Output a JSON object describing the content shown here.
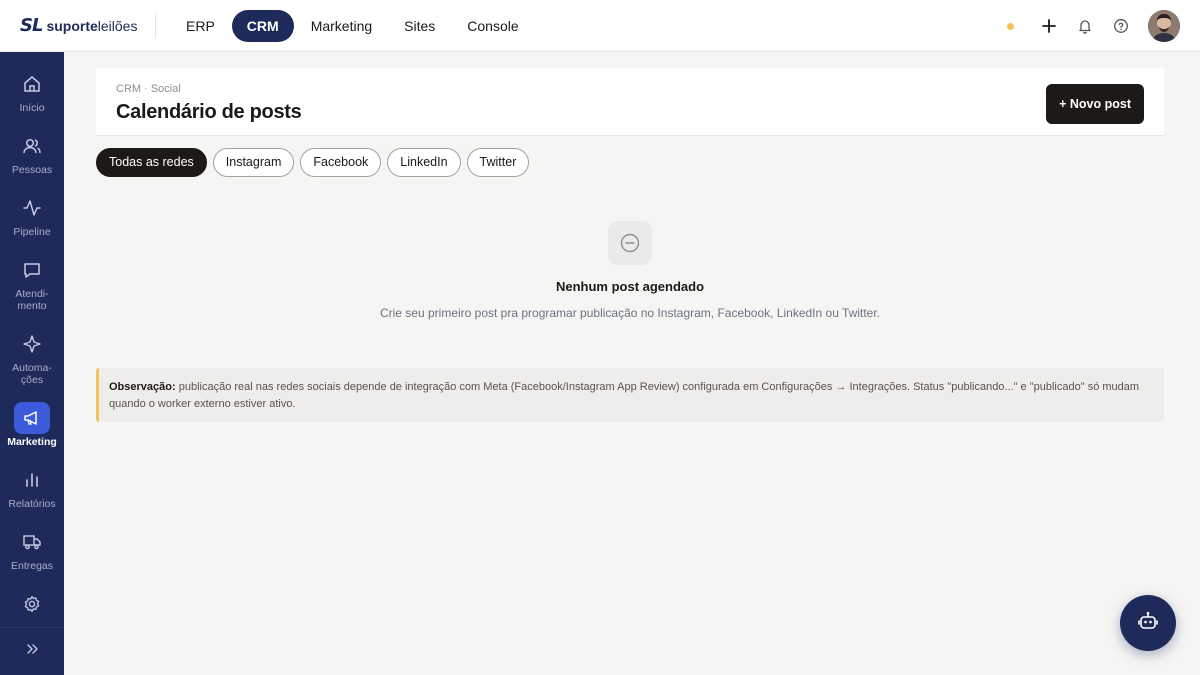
{
  "brand": {
    "mark": "SL",
    "name_bold": "suporte",
    "name_light": "leilões"
  },
  "topnav": {
    "items": [
      {
        "label": "ERP",
        "active": false
      },
      {
        "label": "CRM",
        "active": true
      },
      {
        "label": "Marketing",
        "active": false
      },
      {
        "label": "Sites",
        "active": false
      },
      {
        "label": "Console",
        "active": false
      }
    ]
  },
  "top_actions": {
    "status_color": "#f5c15a",
    "icons": [
      "plus-icon",
      "bell-icon",
      "help-icon"
    ],
    "avatar": "user-avatar"
  },
  "sidebar": {
    "items": [
      {
        "label": "Início",
        "icon": "home-icon"
      },
      {
        "label": "Pessoas",
        "icon": "users-icon"
      },
      {
        "label": "Pipeline",
        "icon": "activity-icon"
      },
      {
        "label": "Atendi-\nmento",
        "icon": "message-icon"
      },
      {
        "label": "Automa-\nções",
        "icon": "sparkle-icon"
      },
      {
        "label": "Marketing",
        "icon": "megaphone-icon",
        "active": true
      },
      {
        "label": "Relatórios",
        "icon": "bar-chart-icon"
      },
      {
        "label": "Entregas",
        "icon": "truck-icon"
      },
      {
        "label": "",
        "icon": "settings-icon"
      }
    ],
    "collapse_icon": "chevrons-right-icon"
  },
  "header": {
    "breadcrumb": "CRM · Social",
    "title": "Calendário de posts",
    "new_post_label": "+ Novo post"
  },
  "filters": [
    {
      "label": "Todas as redes",
      "active": true
    },
    {
      "label": "Instagram",
      "active": false
    },
    {
      "label": "Facebook",
      "active": false
    },
    {
      "label": "LinkedIn",
      "active": false
    },
    {
      "label": "Twitter",
      "active": false
    }
  ],
  "empty_state": {
    "icon": "minus-circle-icon",
    "title": "Nenhum post agendado",
    "subtitle": "Crie seu primeiro post pra programar publicação no Instagram, Facebook, LinkedIn ou Twitter."
  },
  "note": {
    "label": "Observação:",
    "text": "publicação real nas redes sociais depende de integração com Meta (Facebook/Instagram App Review) configurada em Configurações → Integrações. Status \"publicando...\" e \"publicado\" só mudam quando o worker externo estiver ativo."
  },
  "bot": {
    "icon": "bot-icon"
  },
  "colors": {
    "navy": "#1e2a5a",
    "accent_blue": "#3b5bdb",
    "dark": "#1c1917",
    "warning": "#f5c15a"
  }
}
